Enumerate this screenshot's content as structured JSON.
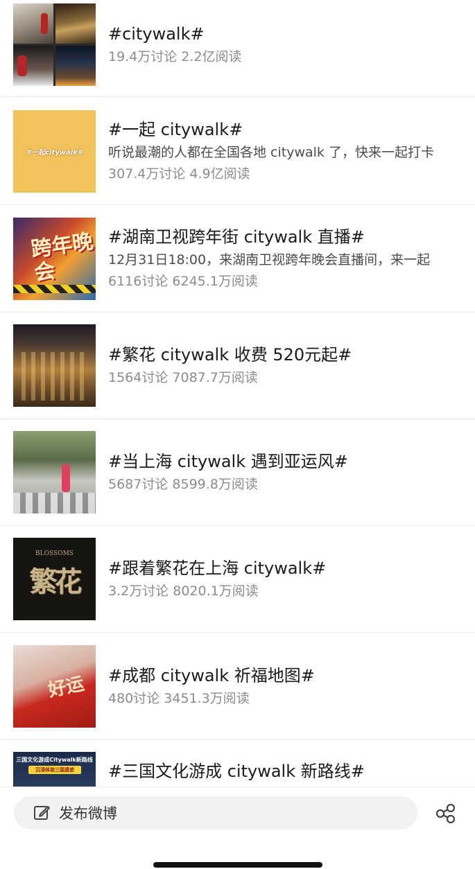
{
  "topics": [
    {
      "title": "#citywalk#",
      "desc": "",
      "stats": "19.4万讨论 2.2亿阅读"
    },
    {
      "title": "#一起 citywalk#",
      "desc": "听说最潮的人都在全国各地 citywalk 了，快来一起打卡",
      "stats": "307.4万讨论 4.9亿阅读"
    },
    {
      "title": "#湖南卫视跨年街 citywalk 直播#",
      "desc": "12月31日18:00，来湖南卫视跨年晚会直播间，来一起",
      "stats": "6116讨论 6245.1万阅读"
    },
    {
      "title": "#繁花 citywalk 收费 520元起#",
      "desc": "",
      "stats": "1564讨论 7087.7万阅读"
    },
    {
      "title": "#当上海 citywalk 遇到亚运风#",
      "desc": "",
      "stats": "5687讨论 8599.8万阅读"
    },
    {
      "title": "#跟着繁花在上海 citywalk#",
      "desc": "",
      "stats": "3.2万讨论 8020.1万阅读"
    },
    {
      "title": "#成都 citywalk 祈福地图#",
      "desc": "",
      "stats": "480讨论 3451.3万阅读"
    },
    {
      "title": "#三国文化游成 citywalk 新路线#",
      "desc": "",
      "stats": ""
    }
  ],
  "thumb_text": {
    "t2": "#一起citywalk#",
    "t3": "跨年晚会",
    "t6_top": "BLOSSOMS",
    "t6_main": "繁花",
    "t7": "好运",
    "t8_line1": "三国文化游成Citywalk新路线",
    "t8_line2": "沉浸体验三国遗迹"
  },
  "bottom_bar": {
    "compose_label": "发布微博",
    "compose_icon": "edit-icon",
    "share_icon": "share-icon"
  }
}
